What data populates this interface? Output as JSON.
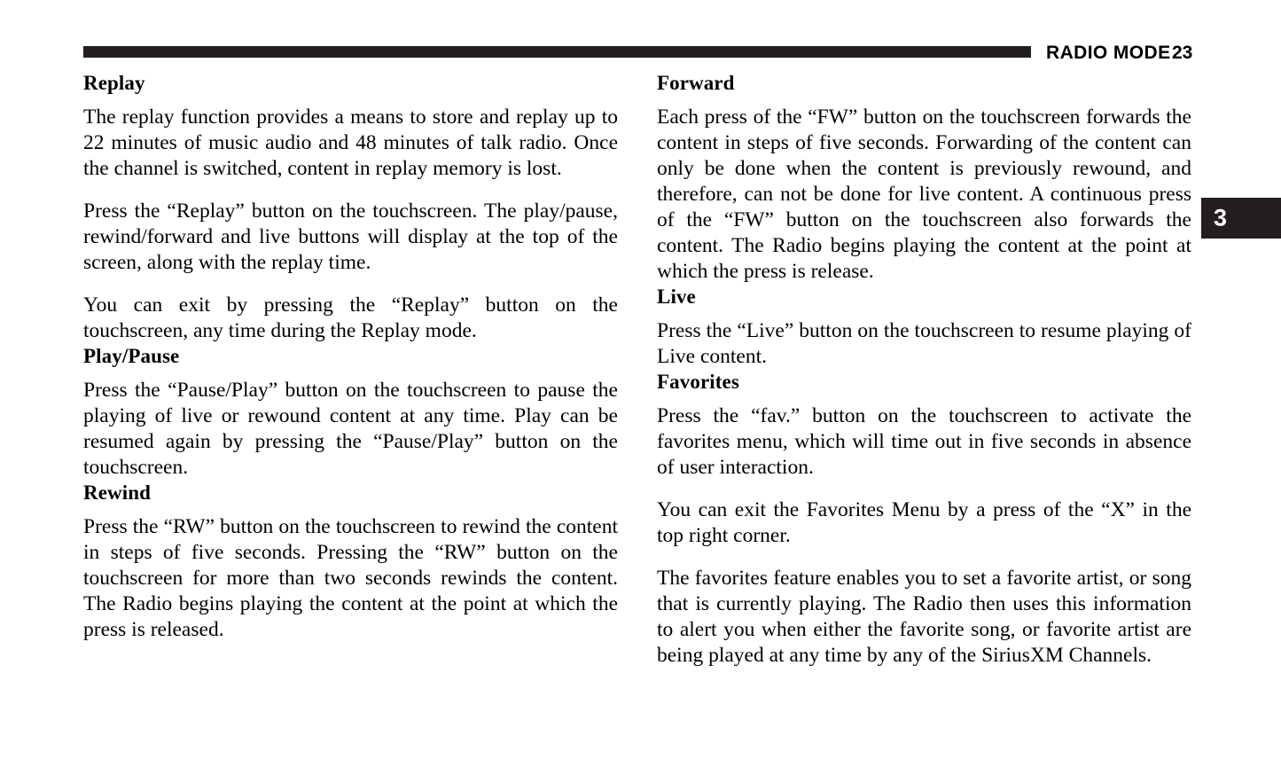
{
  "header": {
    "title": "RADIO MODE",
    "page_number": "23"
  },
  "chapter_tab": {
    "number": "3"
  },
  "columns": {
    "left": {
      "sections": [
        {
          "heading": "Replay",
          "paragraphs": [
            "The replay function provides a means to store and replay up to 22 minutes of music audio and 48 minutes of talk radio. Once the channel is switched, content in replay memory is lost.",
            "Press the “Replay” button on the touchscreen. The play/pause, rewind/forward and live buttons will display at the top of the screen, along with the replay time.",
            "You can exit by pressing the “Replay” button on the touchscreen, any time during the Replay mode."
          ]
        },
        {
          "heading": "Play/Pause",
          "paragraphs": [
            "Press the “Pause/Play” button on the touchscreen to pause the playing of live or rewound content at any time. Play can be resumed again by pressing the “Pause/Play” button on the touchscreen."
          ]
        },
        {
          "heading": "Rewind",
          "paragraphs": [
            "Press the “RW” button on the touchscreen to rewind the content in steps of five seconds. Pressing the “RW” button on the touchscreen for more than two seconds rewinds the content. The Radio begins playing the content at the point at which the press is released."
          ]
        }
      ]
    },
    "right": {
      "sections": [
        {
          "heading": "Forward",
          "paragraphs": [
            "Each press of the “FW” button on the touchscreen forwards the content in steps of five seconds. Forwarding of the content can only be done when the content is previously rewound, and therefore, can not be done for live content. A continuous press of the “FW” button on the touchscreen also forwards the content. The Radio begins playing the content at the point at which the press is release."
          ]
        },
        {
          "heading": "Live",
          "paragraphs": [
            "Press the “Live” button on the touchscreen to resume playing of Live content."
          ]
        },
        {
          "heading": "Favorites",
          "paragraphs": [
            "Press the “fav.” button on the touchscreen to activate the favorites menu, which will time out in five seconds in absence of user interaction.",
            "You can exit the Favorites Menu by a press of the “X” in the top right corner.",
            "The favorites feature enables you to set a favorite artist, or song that is currently playing. The Radio then uses this information to alert you when either the favorite song, or favorite artist are being played at any time by any of the SiriusXM Channels."
          ]
        }
      ]
    }
  },
  "colors": {
    "ink": "#231f1e",
    "page_background": "#ffffff",
    "tab_text": "#ffffff"
  }
}
